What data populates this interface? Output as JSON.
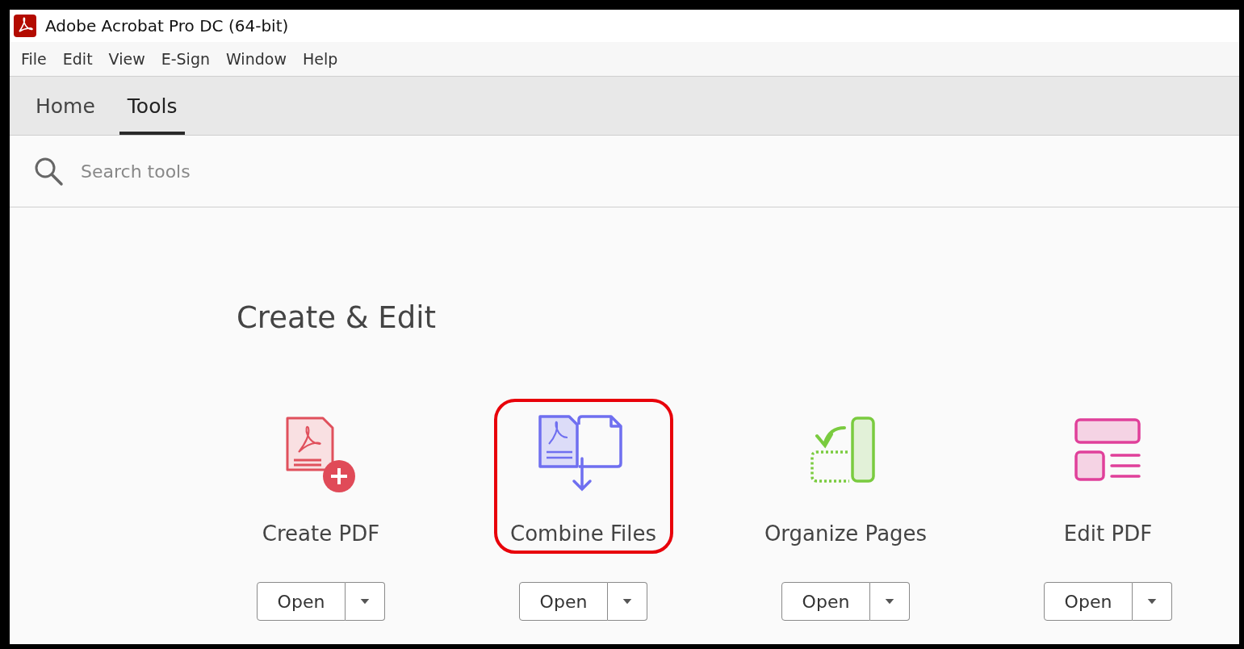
{
  "window": {
    "title": "Adobe Acrobat Pro DC (64-bit)"
  },
  "menu": [
    "File",
    "Edit",
    "View",
    "E-Sign",
    "Window",
    "Help"
  ],
  "tabs": [
    {
      "label": "Home",
      "selected": false
    },
    {
      "label": "Tools",
      "selected": true
    }
  ],
  "search": {
    "placeholder": "Search tools"
  },
  "section": {
    "title": "Create & Edit",
    "tools": [
      {
        "label": "Create PDF",
        "button": "Open",
        "highlighted": false
      },
      {
        "label": "Combine Files",
        "button": "Open",
        "highlighted": true
      },
      {
        "label": "Organize Pages",
        "button": "Open",
        "highlighted": false
      },
      {
        "label": "Edit PDF",
        "button": "Open",
        "highlighted": false
      }
    ]
  }
}
